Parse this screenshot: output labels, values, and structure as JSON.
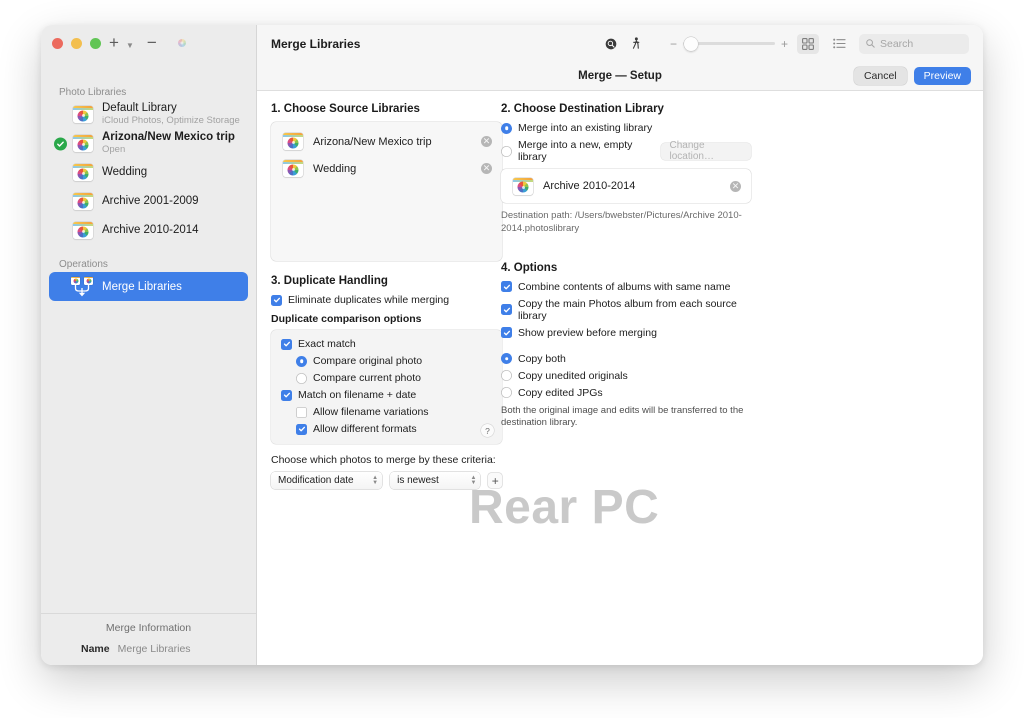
{
  "window": {
    "traffic_lights": [
      "close",
      "minimize",
      "zoom"
    ],
    "sidebar_tools": {
      "add_label": "+",
      "remove_label": "−"
    }
  },
  "sidebar": {
    "sections": [
      {
        "header": "Photo Libraries"
      },
      {
        "header": "Operations"
      }
    ],
    "libraries": [
      {
        "name": "Default Library",
        "sub": "iCloud Photos, Optimize Storage",
        "selected": false,
        "active": false
      },
      {
        "name": "Arizona/New Mexico trip",
        "sub": "Open",
        "selected": true,
        "active": true
      },
      {
        "name": "Wedding",
        "sub": "",
        "selected": false,
        "active": false
      },
      {
        "name": "Archive 2001-2009",
        "sub": "",
        "selected": false,
        "active": false
      },
      {
        "name": "Archive 2010-2014",
        "sub": "",
        "selected": false,
        "active": false
      }
    ],
    "operations": [
      {
        "name": "Merge Libraries",
        "selected": true
      }
    ],
    "info": {
      "title": "Merge Information",
      "name_key": "Name",
      "name_value": "Merge Libraries"
    }
  },
  "toolbar": {
    "title": "Merge Libraries",
    "icons": [
      "search-badge-icon",
      "person-walking-icon"
    ],
    "zoom_slider": {
      "minus": "−",
      "plus": "+",
      "value": 8
    },
    "view_grid": "grid-view-icon",
    "view_list": "list-view-icon",
    "search_placeholder": "Search"
  },
  "subbar": {
    "title": "Merge — Setup",
    "cancel_label": "Cancel",
    "preview_label": "Preview"
  },
  "step1": {
    "title": "1. Choose Source Libraries",
    "sources": [
      {
        "name": "Arizona/New Mexico trip"
      },
      {
        "name": "Wedding"
      }
    ]
  },
  "step2": {
    "title": "2. Choose Destination Library",
    "option_existing": "Merge into an existing library",
    "option_new": "Merge into a new, empty library",
    "mode": "existing",
    "change_location_label": "Change location…",
    "destination": {
      "name": "Archive 2010-2014"
    },
    "destination_path": "Destination path: /Users/bwebster/Pictures/Archive 2010-2014.photoslibrary"
  },
  "step3": {
    "title": "3. Duplicate Handling",
    "eliminate_duplicates": {
      "label": "Eliminate duplicates while merging",
      "checked": true
    },
    "comparison_header": "Duplicate comparison options",
    "exact_match": {
      "label": "Exact match",
      "checked": true
    },
    "compare_original": {
      "label": "Compare original photo",
      "selected": true
    },
    "compare_current": {
      "label": "Compare current photo",
      "selected": false
    },
    "match_filename_date": {
      "label": "Match on filename + date",
      "checked": true
    },
    "allow_filename_variations": {
      "label": "Allow filename variations",
      "checked": false
    },
    "allow_different_formats": {
      "label": "Allow different formats",
      "checked": true
    },
    "help_label": "?",
    "criteria_label": "Choose which photos to merge by these criteria:",
    "criteria_field": "Modification date",
    "criteria_comparator": "is newest",
    "add_criteria_label": "+"
  },
  "step4": {
    "title": "4. Options",
    "checkboxes": [
      {
        "label": "Combine contents of albums with same name",
        "checked": true
      },
      {
        "label": "Copy the main Photos album from each source library",
        "checked": true
      },
      {
        "label": "Show preview before merging",
        "checked": true
      }
    ],
    "copy_mode": "both",
    "radios": [
      {
        "label": "Copy both",
        "selected": true
      },
      {
        "label": "Copy unedited originals",
        "selected": false
      },
      {
        "label": "Copy edited JPGs",
        "selected": false
      }
    ],
    "note": "Both the original image and edits will be transferred to the destination library."
  },
  "watermark": {
    "text": "Rear PC"
  },
  "colors": {
    "accent": "#3f7fe8",
    "sidebar_bg": "#ececec",
    "toolbar_bg": "#f6f6f6",
    "check_green": "#2aa84a",
    "watermark": "#c9c9c9"
  }
}
